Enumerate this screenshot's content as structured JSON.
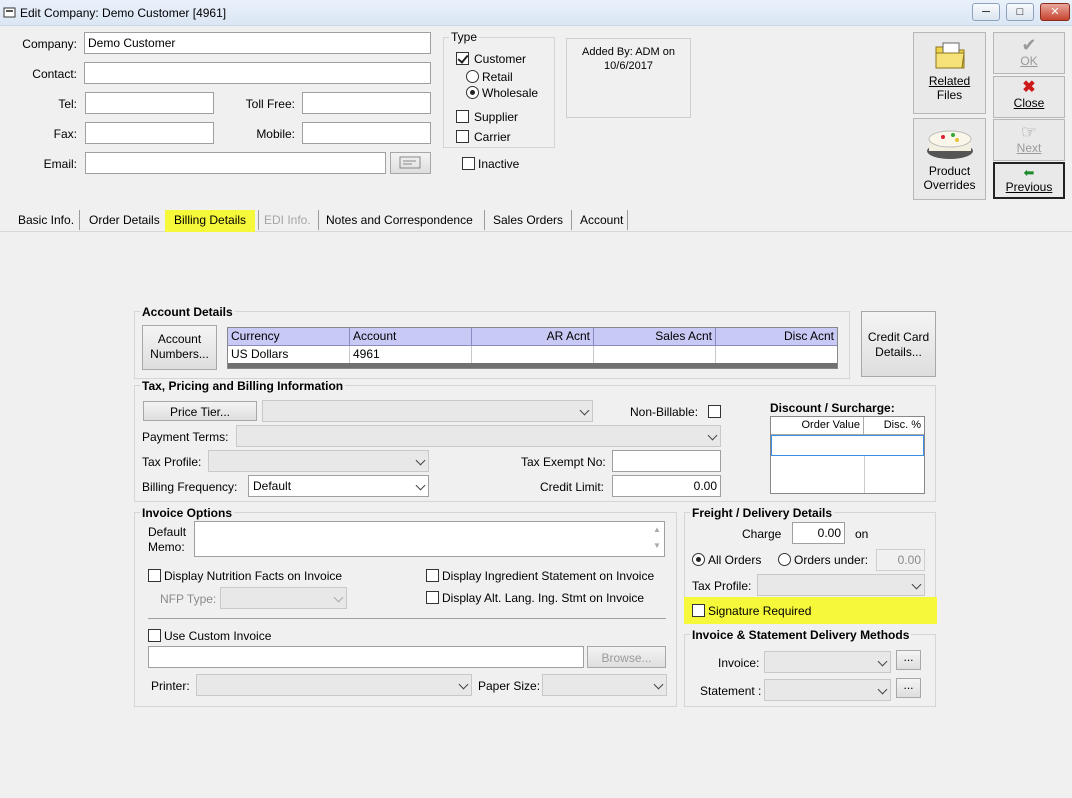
{
  "window": {
    "title": "Edit Company: Demo Customer [4961]"
  },
  "header": {
    "company_label": "Company:",
    "company_value": "Demo Customer",
    "contact_label": "Contact:",
    "contact_value": "",
    "tel_label": "Tel:",
    "tel_value": "",
    "tollfree_label": "Toll Free:",
    "tollfree_value": "",
    "fax_label": "Fax:",
    "fax_value": "",
    "mobile_label": "Mobile:",
    "mobile_value": "",
    "email_label": "Email:",
    "email_value": ""
  },
  "type_group": {
    "title": "Type",
    "customer": "Customer",
    "retail": "Retail",
    "wholesale": "Wholesale",
    "supplier": "Supplier",
    "carrier": "Carrier",
    "inactive": "Inactive"
  },
  "added_by": {
    "line1": "Added By: ADM on",
    "line2": "10/6/2017"
  },
  "side_buttons": {
    "related_files_1": "Related",
    "related_files_2": "Files",
    "ok": "OK",
    "close": "Close",
    "next": "Next",
    "product_overrides_1": "Product",
    "product_overrides_2": "Overrides",
    "previous": "Previous"
  },
  "tabs": [
    "Basic Info.",
    "Order Details",
    "Billing Details",
    "EDI Info.",
    "Notes and Correspondence",
    "Sales Orders",
    "Account"
  ],
  "account_details": {
    "title": "Account Details",
    "account_numbers_1": "Account",
    "account_numbers_2": "Numbers...",
    "columns": [
      "Currency",
      "Account",
      "AR Acnt",
      "Sales Acnt",
      "Disc Acnt"
    ],
    "rows": [
      [
        "US Dollars",
        "4961",
        "",
        "",
        ""
      ]
    ],
    "credit_card_1": "Credit Card",
    "credit_card_2": "Details..."
  },
  "tax_pricing": {
    "title": "Tax, Pricing and Billing Information",
    "price_tier": "Price Tier...",
    "non_billable": "Non-Billable:",
    "payment_terms": "Payment Terms:",
    "tax_profile": "Tax Profile:",
    "tax_exempt_no": "Tax Exempt No:",
    "billing_frequency": "Billing Frequency:",
    "billing_frequency_value": "Default",
    "credit_limit": "Credit Limit:",
    "credit_limit_value": "0.00",
    "discount_title": "Discount / Surcharge:",
    "discount_columns": [
      "Order Value",
      "Disc. %"
    ]
  },
  "invoice_options": {
    "title": "Invoice Options",
    "default_memo_1": "Default",
    "default_memo_2": "Memo:",
    "nutrition": "Display Nutrition Facts on Invoice",
    "ingredient": "Display Ingredient Statement on Invoice",
    "nfp_type": "NFP Type:",
    "alt_lang": "Display Alt. Lang. Ing. Stmt on Invoice",
    "custom_invoice": "Use Custom Invoice",
    "browse": "Browse...",
    "printer": "Printer:",
    "paper_size": "Paper Size:"
  },
  "freight": {
    "title": "Freight / Delivery Details",
    "charge": "Charge",
    "charge_value": "0.00",
    "on": "on",
    "all_orders": "All Orders",
    "orders_under": "Orders under:",
    "orders_under_value": "0.00",
    "tax_profile": "Tax Profile:",
    "signature": "Signature Required"
  },
  "delivery_methods": {
    "title": "Invoice & Statement Delivery Methods",
    "invoice": "Invoice:",
    "statement": "Statement :",
    "dots": "..."
  },
  "colors": {
    "highlight": "#f6f83a",
    "grid_header": "#c9c9f5",
    "close_x": "#cc1a1a"
  },
  "icons": [
    "app-icon",
    "minimize-icon",
    "maximize-icon",
    "close-window-icon",
    "folder-icon",
    "checkmark-icon",
    "red-x-icon",
    "hand-pointer-icon",
    "cake-icon",
    "back-arrow-icon",
    "email-lookup-icon"
  ]
}
